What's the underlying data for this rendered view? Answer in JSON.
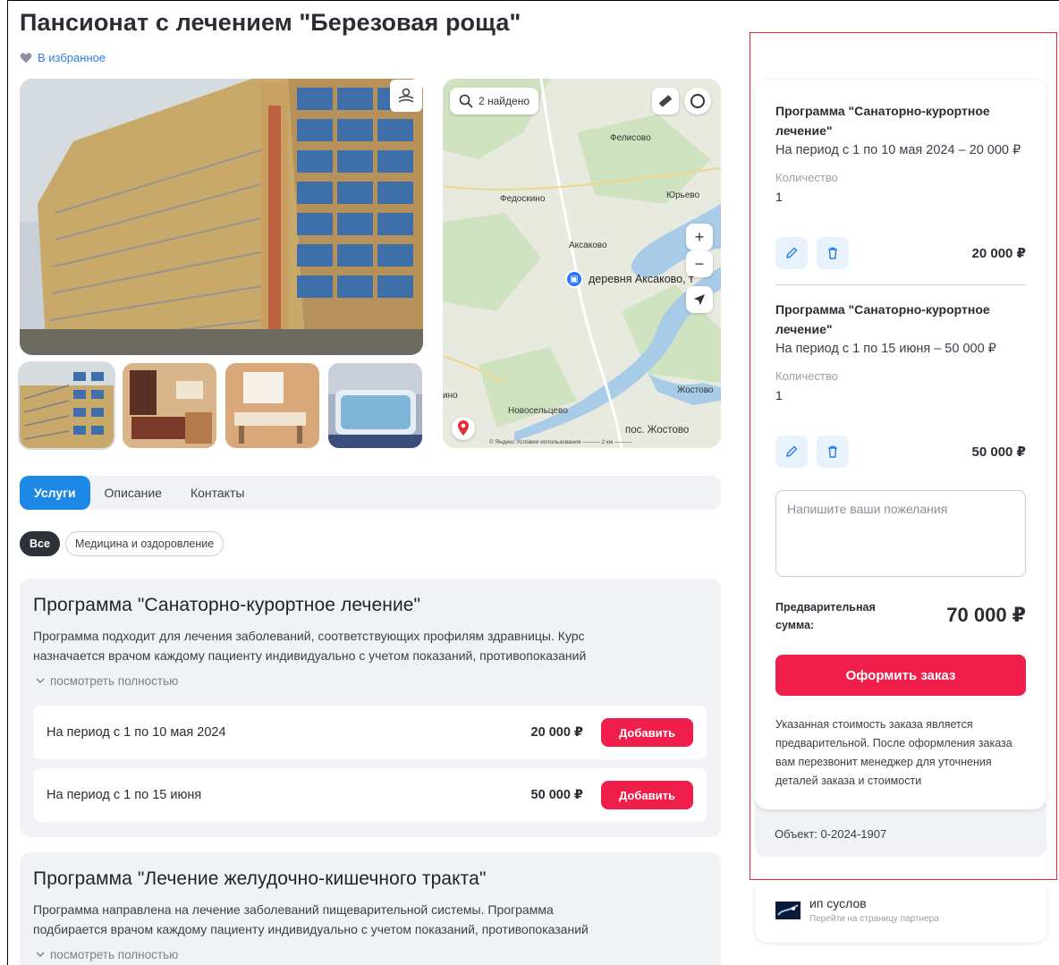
{
  "header": {
    "title": "Пансионат с лечением \"Березовая роща\"",
    "favorite_label": "В избранное"
  },
  "map": {
    "search_label": "2 найдено",
    "zoom_in": "+",
    "zoom_out": "−",
    "places": [
      "Фелисово",
      "Федоскино",
      "Юрьево",
      "Аксаково",
      "Жостово",
      "Новосельцево",
      "пос. Жостово",
      "ино"
    ],
    "marker_label": "деревня Аксаково, т",
    "copyright": "© Яндекс  Условия использования  ——— 2 км ———"
  },
  "tabs": [
    "Услуги",
    "Описание",
    "Контакты"
  ],
  "filters": [
    "Все",
    "Медицина и оздоровление"
  ],
  "programs": [
    {
      "title": "Программа \"Санаторно-курортное лечение\"",
      "desc_line1": "Программа подходит для лечения заболеваний, соответствующих профилям здравницы. Курс",
      "desc_line2": "назначается врачом каждому пациенту индивидуально с учетом показаний, противопоказаний",
      "more": "посмотреть полностью",
      "offers": [
        {
          "label": "На период с 1 по 10 мая 2024",
          "price": "20 000 ₽",
          "button": "Добавить"
        },
        {
          "label": "На период с 1 по 15 июня",
          "price": "50 000 ₽",
          "button": "Добавить"
        }
      ]
    },
    {
      "title": "Программа \"Лечение желудочно-кишечного тракта\"",
      "desc_line1": "Программа направлена на лечение заболеваний пищеварительной системы. Программа",
      "desc_line2": "подбирается врачом каждому пациенту индивидуально с учетом показаний, противопоказаний",
      "more": "посмотреть полностью"
    }
  ],
  "cart": {
    "items": [
      {
        "title": "Программа \"Санаторно-курортное лечение\"",
        "period": "На период с 1 по 10 мая 2024 – 20 000 ₽",
        "qty_label": "Количество",
        "qty": "1",
        "sum": "20 000 ₽"
      },
      {
        "title": "Программа \"Санаторно-курортное лечение\"",
        "period": "На период с 1 по 15 июня – 50 000 ₽",
        "qty_label": "Количество",
        "qty": "1",
        "sum": "50 000 ₽"
      }
    ],
    "wishes_placeholder": "Напишите ваши пожелания",
    "pre_label": "Предварительная сумма:",
    "pre_sum": "70 000 ₽",
    "order_button": "Оформить заказ",
    "note": "Указанная стоимость заказа является предварительной. После оформления заказа вам перезвонит менеджер для уточнения деталей заказа и стоимости",
    "object_code": "Объект: 0-2024-1907"
  },
  "partner": {
    "name": "ип суслов",
    "link": "Перейти на страницу партнера"
  },
  "colors": {
    "accent_blue": "#1e88e5",
    "accent_red": "#f01e4b",
    "highlight_frame": "#e32636"
  }
}
